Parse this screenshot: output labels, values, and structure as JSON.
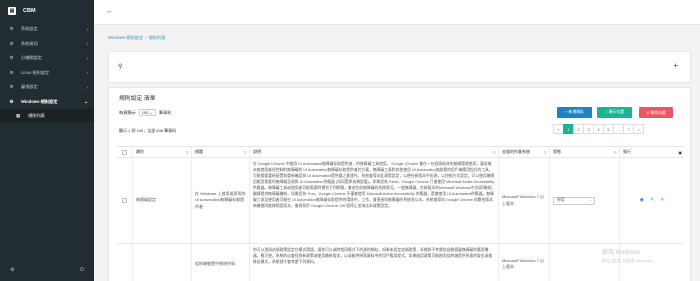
{
  "brand": {
    "name": "CBM",
    "logo_icon": "book-icon"
  },
  "sidebar": {
    "items": [
      {
        "label": "系統設定",
        "icon": "gear-icon"
      },
      {
        "label": "系統資訊",
        "icon": "gear-icon"
      },
      {
        "label": "分機關設定",
        "icon": "gear-icon"
      },
      {
        "label": "Linux-規則設定",
        "icon": "gear-icon"
      },
      {
        "label": "審視設定",
        "icon": "gear-icon"
      },
      {
        "label": "Windows-規則設定",
        "icon": "gear-icon"
      }
    ],
    "sub_items": [
      {
        "label": "規則列表",
        "icon": "grid-icon"
      }
    ]
  },
  "breadcrumb": {
    "item1": "Windows-規則設定",
    "separator": "/",
    "item2": "規則列表"
  },
  "panel": {
    "title": "規則設定 清單",
    "page_size_prefix": "每頁顯示",
    "page_size_value": "100",
    "page_size_suffix": "筆資料",
    "record_info": "顯示 1 到 100，全部 636 筆資料",
    "buttons": {
      "add": "+ 新增資料",
      "show": "✓ 顯示勾選",
      "delete": "✕ 刪除勾選"
    }
  },
  "pagination": [
    "<",
    "1",
    "2",
    "3",
    "4",
    "5",
    "...",
    "7",
    ">"
  ],
  "table": {
    "headers": [
      "類別",
      "標題",
      "說明",
      "支援的作業系統",
      "狀態",
      "執行"
    ],
    "rows": [
      {
        "category": "無障礙設定",
        "title": "在 Windows 上啟用或停用的 UI Automation無障礙存取提供者",
        "description": "在 Google Chrome 中啟用 UI Automation無障礙存取提供者，供無障礙工具使用。 Google Chrome 會在一台經過修改的基礎環境使用，讓這樣未被使用者所控制的無障礙的 UI Automation無障礙存取提供者於方案，無障礙工具和其他使用 UI Automation協助實的用戶端應用程式的工具，可能需要重新配置和重新確認與 UI Automation提供器之意運作，系統會導向此政策設定，以便在新版本中出現，以控制方式設定。可以使用確實回報您需要的無障礙呈現與 UI Automation供應器 (如同還原為預設值)。如果設為 False，Google Chrome 只會使用 Microsoft Active Accessibility 供應器。無障礙工具或使用者可能需要時遇到下列問題，會這些與無障礙的系統狀況。一般無障礙。在新版本的Microsoft Windows中(如同預前)翻譯提供無障礙機制，如果設為 True，Google Chrome 不僅會使用 Microsoft Active Accessibility 供應器，還會使用 UI Automation供應器。無障礙工具及使用者可能在 UI Automation無障礙存取提供的環境中，工作。會直接與無障礙的系統並以本，系統會導向 Google Chrome 的關也版本新機會同推移相容版本，後例如於 Google Chrome 136 版停止並淘汰本政策設定。",
        "os": "Microsoft Windows 7 以上版本",
        "status": "停用"
      },
      {
        "category": "",
        "title": "從終端裝置中移除拼寫",
        "description": "你可以透過這項政策設定在模式環境，讓你可以或時相同模式下的源的網站，如果未設定這項政策，系統將不考慮從自動隨載無障礙的應用機器，應可使。系統的自會找到新政策或使用最新版本，以或較供拼寫資料中的用戶應用程式。如果啟用政策可能啟用從終端提供所需的發出或推移此模式，系統就不會考慮下列資料。",
        "os": "Microsoft Windows 7 以上版本",
        "status": ""
      }
    ]
  },
  "icons": {
    "view": "eye-icon",
    "edit": "pencil-icon",
    "delete": "close-icon"
  },
  "watermark": {
    "line1": "啟用 Windows",
    "line2": "移至 [設定] 以啟用 Windows。"
  },
  "colors": {
    "sidebar": "#222d32",
    "primary": "#1c84c6",
    "success": "#1ab394",
    "danger": "#ed5565"
  }
}
